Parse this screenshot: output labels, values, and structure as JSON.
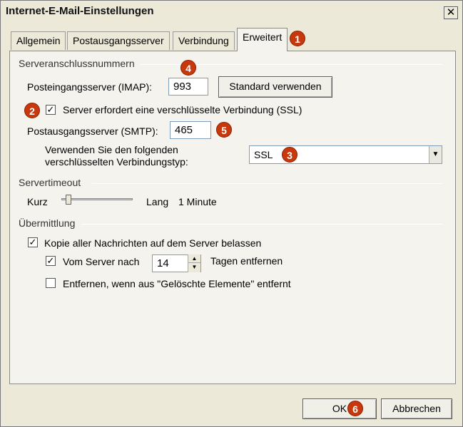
{
  "window": {
    "title": "Internet-E-Mail-Einstellungen",
    "close_glyph": "✕"
  },
  "tabs": [
    {
      "label": "Allgemein"
    },
    {
      "label": "Postausgangsserver"
    },
    {
      "label": "Verbindung"
    },
    {
      "label": "Erweitert"
    }
  ],
  "server_ports": {
    "group_label": "Serveranschlussnummern",
    "imap_label": "Posteingangsserver (IMAP):",
    "imap_value": "993",
    "default_button": "Standard verwenden",
    "ssl_checkbox_label": "Server erfordert eine verschlüsselte Verbindung (SSL)",
    "ssl_checked": true,
    "smtp_label": "Postausgangsserver (SMTP):",
    "smtp_value": "465",
    "encryption_label_line1": "Verwenden Sie den folgenden",
    "encryption_label_line2": "verschlüsselten Verbindungstyp:",
    "encryption_value": "SSL"
  },
  "timeout": {
    "group_label": "Servertimeout",
    "short_label": "Kurz",
    "long_label": "Lang",
    "value_text": "1 Minute",
    "slider_fraction": 0.1
  },
  "delivery": {
    "group_label": "Übermittlung",
    "keep_copy_label": "Kopie aller Nachrichten auf dem Server belassen",
    "keep_copy_checked": true,
    "remove_after_label": "Vom Server nach",
    "remove_after_checked": true,
    "remove_days": "14",
    "remove_days_suffix": "Tagen entfernen",
    "remove_deleted_label": "Entfernen, wenn aus \"Gelöschte Elemente\" entfernt",
    "remove_deleted_checked": false
  },
  "footer": {
    "ok_label": "OK",
    "cancel_label": "Abbrechen"
  },
  "markers": [
    "1",
    "2",
    "3",
    "4",
    "5",
    "6"
  ],
  "colors": {
    "marker": "#c9380c",
    "dialog_bg": "#ece9d8"
  }
}
